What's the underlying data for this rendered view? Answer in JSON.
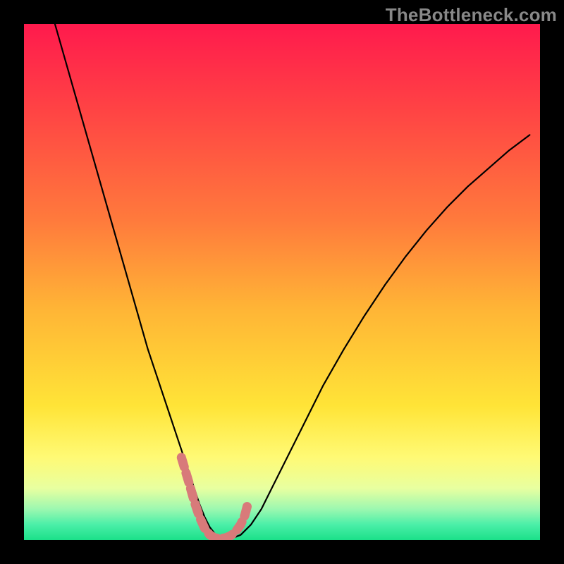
{
  "attribution": "TheBottleneck.com",
  "chart_data": {
    "type": "line",
    "title": "",
    "xlabel": "",
    "ylabel": "",
    "xlim": [
      0,
      100
    ],
    "ylim": [
      0,
      100
    ],
    "grid": false,
    "legend": false,
    "series": [
      {
        "name": "bottleneck-curve",
        "x": [
          6,
          8,
          10,
          12,
          14,
          16,
          18,
          20,
          22,
          24,
          26,
          28,
          30,
          32,
          33,
          34,
          35,
          36,
          37,
          38,
          40,
          42,
          44,
          46,
          48,
          50,
          54,
          58,
          62,
          66,
          70,
          74,
          78,
          82,
          86,
          90,
          94,
          98
        ],
        "y": [
          100,
          93,
          86,
          79,
          72,
          65,
          58,
          51,
          44,
          37,
          31,
          25,
          19,
          13,
          10,
          7,
          4.5,
          2.5,
          1.2,
          0.5,
          0.2,
          1,
          3,
          6,
          10,
          14,
          22,
          30,
          37,
          43.5,
          49.5,
          55,
          60,
          64.5,
          68.5,
          72,
          75.5,
          78.5
        ]
      }
    ],
    "highlight_segment": {
      "name": "optimal-range-marker",
      "x": [
        30.5,
        32,
        33,
        34,
        35,
        36,
        37,
        38,
        39,
        40,
        41,
        42,
        42.8,
        43.5
      ],
      "y": [
        16,
        11,
        7.5,
        4.5,
        2.3,
        1.0,
        0.4,
        0.3,
        0.4,
        0.8,
        1.6,
        3.0,
        4.8,
        7.5
      ]
    },
    "colors": {
      "curve": "#000000",
      "highlight": "#d87a7a"
    }
  }
}
